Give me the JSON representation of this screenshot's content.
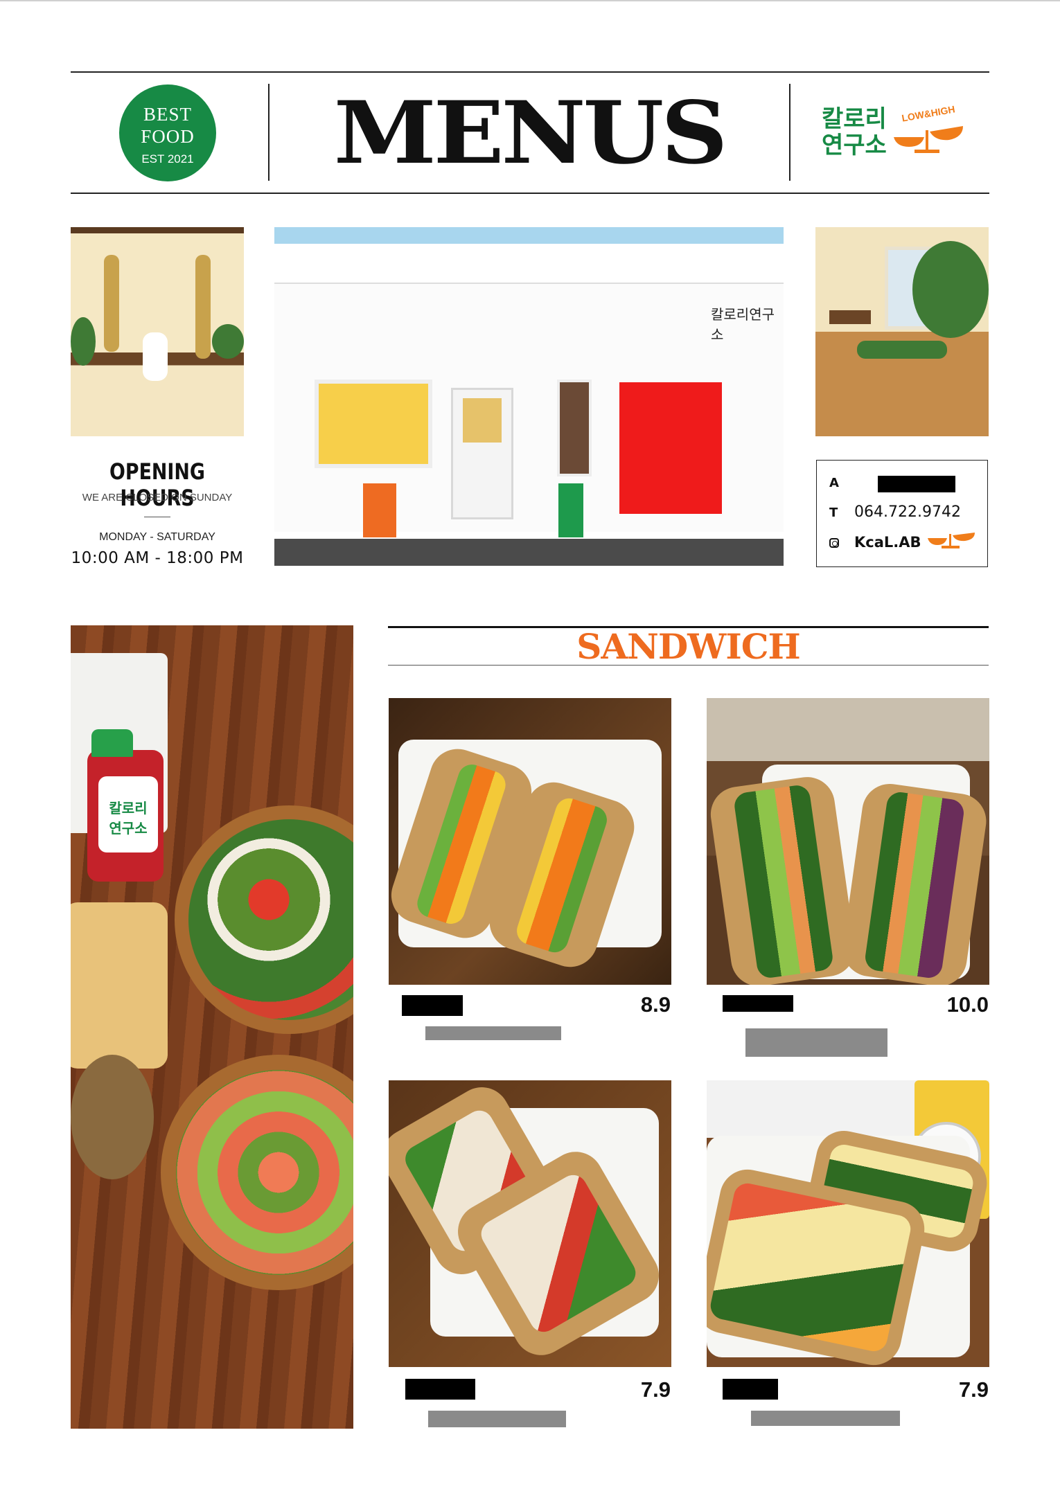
{
  "header": {
    "badge": {
      "line1": "BEST",
      "line2": "FOOD",
      "line3": "EST 2021"
    },
    "title": "MENUS",
    "brand": {
      "line1": "칼로리",
      "line2": "연구소",
      "tagline": "LOW&HIGH"
    }
  },
  "storefront": {
    "sign_text": "칼로리연구소"
  },
  "hours": {
    "title": "OPENING HOURS",
    "closed_note": "WE ARE CLOSED ON SUNDAY",
    "days": "MONDAY - SATURDAY",
    "time": "10:00 AM - 18:00 PM"
  },
  "contact": {
    "address_label": "A",
    "phone_label": "T",
    "phone": "064.722.9742",
    "instagram": "KcaL.AB"
  },
  "salad_photo": {
    "bottle_label_1": "칼로리",
    "bottle_label_2": "연구소"
  },
  "section": {
    "title": "SANDWICH"
  },
  "items": [
    {
      "price": "8.9"
    },
    {
      "price": "10.0"
    },
    {
      "price": "7.9"
    },
    {
      "price": "7.9"
    }
  ],
  "colors": {
    "brand_green": "#178a45",
    "accent_orange": "#ee6b1f"
  },
  "icons": [
    "instagram-icon",
    "scale-icon"
  ]
}
